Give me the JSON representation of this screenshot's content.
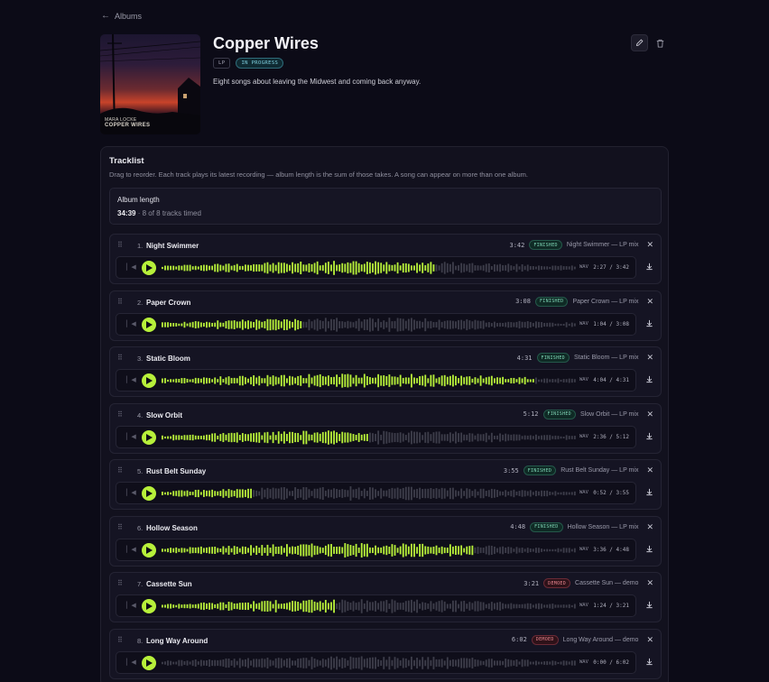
{
  "nav": {
    "back_label": "Albums"
  },
  "album": {
    "title": "Copper Wires",
    "format_badge": "LP",
    "status_badge": "IN PROGRESS",
    "description": "Eight songs about leaving the Midwest and coming back anyway.",
    "cover": {
      "line1": "MARA LOCKE",
      "line2": "COPPER WIRES"
    }
  },
  "tracklist": {
    "title": "Tracklist",
    "subtitle": "Drag to reorder. Each track plays its latest recording — album length is the sum of those takes. A song can appear on more than one album.",
    "length_label": "Album length",
    "length_value": "34:39",
    "length_note": "· 8 of 8 tracks timed"
  },
  "colors": {
    "accent": "#b7f03a",
    "finished": "#7fd6b6",
    "demoed": "#e8848e",
    "progress": "#7fd0e0"
  },
  "tracks": [
    {
      "num": "1.",
      "name": "Night Swimmer",
      "duration": "3:42",
      "status": "FINISHED",
      "status_type": "finished",
      "recording": "Night Swimmer — LP mix",
      "format": "WAV",
      "time": "2:27 / 3:42",
      "progress": 0.66
    },
    {
      "num": "2.",
      "name": "Paper Crown",
      "duration": "3:08",
      "status": "FINISHED",
      "status_type": "finished",
      "recording": "Paper Crown — LP mix",
      "format": "WAV",
      "time": "1:04 / 3:08",
      "progress": 0.34
    },
    {
      "num": "3.",
      "name": "Static Bloom",
      "duration": "4:31",
      "status": "FINISHED",
      "status_type": "finished",
      "recording": "Static Bloom — LP mix",
      "format": "WAV",
      "time": "4:04 / 4:31",
      "progress": 0.9
    },
    {
      "num": "4.",
      "name": "Slow Orbit",
      "duration": "5:12",
      "status": "FINISHED",
      "status_type": "finished",
      "recording": "Slow Orbit — LP mix",
      "format": "WAV",
      "time": "2:36 / 5:12",
      "progress": 0.5
    },
    {
      "num": "5.",
      "name": "Rust Belt Sunday",
      "duration": "3:55",
      "status": "FINISHED",
      "status_type": "finished",
      "recording": "Rust Belt Sunday — LP mix",
      "format": "WAV",
      "time": "0:52 / 3:55",
      "progress": 0.22
    },
    {
      "num": "6.",
      "name": "Hollow Season",
      "duration": "4:48",
      "status": "FINISHED",
      "status_type": "finished",
      "recording": "Hollow Season — LP mix",
      "format": "WAV",
      "time": "3:36 / 4:48",
      "progress": 0.75
    },
    {
      "num": "7.",
      "name": "Cassette Sun",
      "duration": "3:21",
      "status": "DEMOED",
      "status_type": "demoed",
      "recording": "Cassette Sun — demo",
      "format": "WAV",
      "time": "1:24 / 3:21",
      "progress": 0.42
    },
    {
      "num": "8.",
      "name": "Long Way Around",
      "duration": "6:02",
      "status": "DEMOED",
      "status_type": "demoed",
      "recording": "Long Way Around — demo",
      "format": "WAV",
      "time": "0:00 / 6:02",
      "progress": 0
    }
  ]
}
